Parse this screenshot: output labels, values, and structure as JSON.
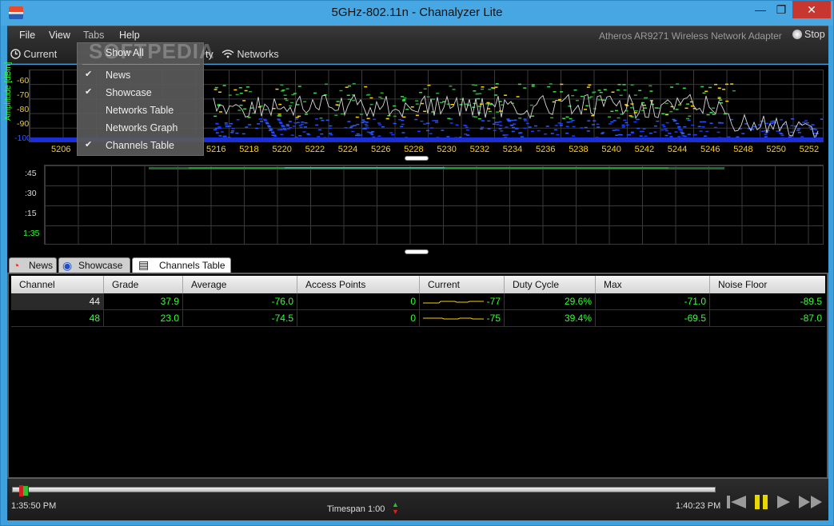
{
  "window": {
    "title": "5GHz-802.11n - Chanalyzer Lite",
    "minimize": "—",
    "maximize": "❐",
    "close": "✕"
  },
  "menu": {
    "items": [
      "File",
      "View",
      "Tabs",
      "Help"
    ],
    "adapter": "Atheros AR9271 Wireless Network Adapter",
    "stop_label": "Stop"
  },
  "toolbar": {
    "current_label": "Current",
    "density_fragment": "ty",
    "networks_label": "Networks"
  },
  "tabs_dropdown": {
    "items": [
      {
        "label": "Show All",
        "checked": false
      },
      {
        "label": "News",
        "checked": true
      },
      {
        "label": "Showcase",
        "checked": true
      },
      {
        "label": "Networks Table",
        "checked": false
      },
      {
        "label": "Networks Graph",
        "checked": false
      },
      {
        "label": "Channels Table",
        "checked": true
      }
    ],
    "check_glyph": "✔"
  },
  "watermark": "SOFTPEDIA",
  "spectrum": {
    "ylabel": "Amplitude [dBm]",
    "yticks": [
      "-60",
      "-70",
      "-80",
      "-90",
      "-100"
    ],
    "xticks": [
      "5206",
      "5216",
      "5218",
      "5220",
      "5222",
      "5224",
      "5226",
      "5228",
      "5230",
      "5232",
      "5234",
      "5236",
      "5238",
      "5240",
      "5242",
      "5244",
      "5246",
      "5248",
      "5250",
      "5252"
    ]
  },
  "waterfall": {
    "yticks": [
      ":45",
      ":30",
      ":15",
      "1:35"
    ]
  },
  "bottom_tabs": [
    {
      "label": "News",
      "icon": "rss-icon",
      "active": false
    },
    {
      "label": "Showcase",
      "icon": "broadcast-icon",
      "active": false
    },
    {
      "label": "Channels Table",
      "icon": "table-icon",
      "active": true
    }
  ],
  "channels_table": {
    "columns": [
      "Channel",
      "Grade",
      "Average",
      "Access Points",
      "Current",
      "Duty Cycle",
      "Max",
      "Noise Floor"
    ],
    "rows": [
      {
        "channel": "44",
        "grade": "37.9",
        "average": "-76.0",
        "access_points": "0",
        "current": "-77",
        "duty_cycle": "29.6%",
        "max": "-71.0",
        "noise_floor": "-89.5"
      },
      {
        "channel": "48",
        "grade": "23.0",
        "average": "-74.5",
        "access_points": "0",
        "current": "-75",
        "duty_cycle": "39.4%",
        "max": "-69.5",
        "noise_floor": "-87.0"
      }
    ]
  },
  "playback": {
    "start_time": "1:35:50 PM",
    "end_time": "1:40:23 PM",
    "timespan": "Timespan 1:00",
    "position": 0.01
  },
  "colors": {
    "accent_green": "#33ff33",
    "tick_yellow": "#ffd000",
    "window_blue": "#46a7e3"
  }
}
